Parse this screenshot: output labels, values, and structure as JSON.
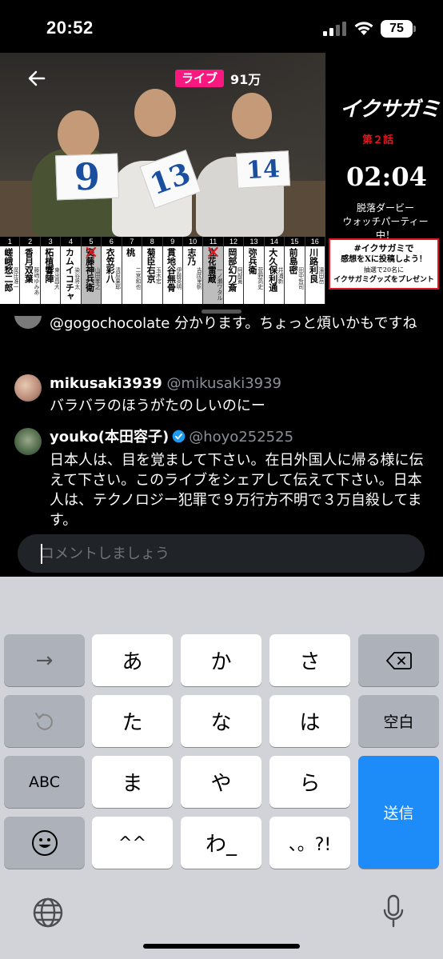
{
  "status_bar": {
    "time": "20:52",
    "battery": "75"
  },
  "video": {
    "live_label": "ライブ",
    "viewer_count": "91万",
    "cards": [
      "9",
      "13",
      "14"
    ],
    "ranking": [
      {
        "num": "1",
        "name": "嵯峨愁二郎",
        "player": "岡田准一",
        "out": false
      },
      {
        "num": "2",
        "name": "香月双葉",
        "player": "藤﨑ゆみあ",
        "out": false
      },
      {
        "num": "3",
        "name": "柘植響陣",
        "player": "東出昌大",
        "out": false
      },
      {
        "num": "4",
        "name": "カムイコチャ",
        "player": "染谷将太",
        "out": false
      },
      {
        "num": "5",
        "name": "安藤神兵衛",
        "player": "山田孝之",
        "out": true
      },
      {
        "num": "6",
        "name": "衣笠彩八",
        "player": "清原果耶",
        "out": false
      },
      {
        "num": "7",
        "name": "桃",
        "player": "二宮和也",
        "out": false
      },
      {
        "num": "8",
        "name": "菊臣右京",
        "player": "玉木宏",
        "out": false
      },
      {
        "num": "9",
        "name": "貫地谷無骨",
        "player": "伊藤英明",
        "out": false
      },
      {
        "num": "10",
        "name": "志乃",
        "player": "吉岡里帆",
        "out": false
      },
      {
        "num": "11",
        "name": "立花雷蔵",
        "player": "一ノ瀬ワタル",
        "out": true
      },
      {
        "num": "12",
        "name": "岡部幻刀斎",
        "player": "阿部寛",
        "out": false
      },
      {
        "num": "13",
        "name": "弥兵衛",
        "player": "菅野高史",
        "out": false
      },
      {
        "num": "14",
        "name": "大久保利通",
        "player": "井浦新",
        "out": false
      },
      {
        "num": "15",
        "name": "前島密",
        "player": "田中哲司",
        "out": false
      },
      {
        "num": "16",
        "name": "川路利良",
        "player": "濱田岳",
        "out": false
      }
    ],
    "side_panel": {
      "title": "イクサガミ",
      "episode": "第２話",
      "timer": "02:04",
      "desc_line1": "脱落ダービー",
      "desc_line2": "ウォッチパーティー中！",
      "promo_line1": "#イクサガミで",
      "promo_line2": "感想をXに投稿しよう！",
      "promo_line3": "抽選で20名に",
      "promo_line4": "イクサガミグッズをプレゼント"
    }
  },
  "comments": [
    {
      "name": "",
      "handle": "",
      "text": "@gogochocolate 分かります。ちょっと煩いかもですね"
    },
    {
      "name": "mikusaki3939",
      "handle": "@mikusaki3939",
      "text": "バラバラのほうがたのしいのにー"
    },
    {
      "name": "youko(本田容子)",
      "handle": "@hoyo252525",
      "text": "日本人は、目を覚まして下さい。在日外国人に帰る様に伝えて下さい。このライブをシェアして伝えて下さい。日本人は、テクノロジー犯罪で９万行方不明で３万自殺してます。"
    }
  ],
  "input": {
    "placeholder": "コメントしましょう"
  },
  "keyboard": {
    "row1": [
      "→",
      "あ",
      "か",
      "さ"
    ],
    "row2": [
      "た",
      "な",
      "は",
      "空白"
    ],
    "row3": [
      "ABC",
      "ま",
      "や",
      "ら",
      "送信"
    ],
    "row4": [
      "^^",
      "わ_",
      "、。?!"
    ]
  },
  "colors": {
    "accent": "#1d8cf8",
    "live": "#f91880",
    "eliminated": "#e0161e"
  }
}
